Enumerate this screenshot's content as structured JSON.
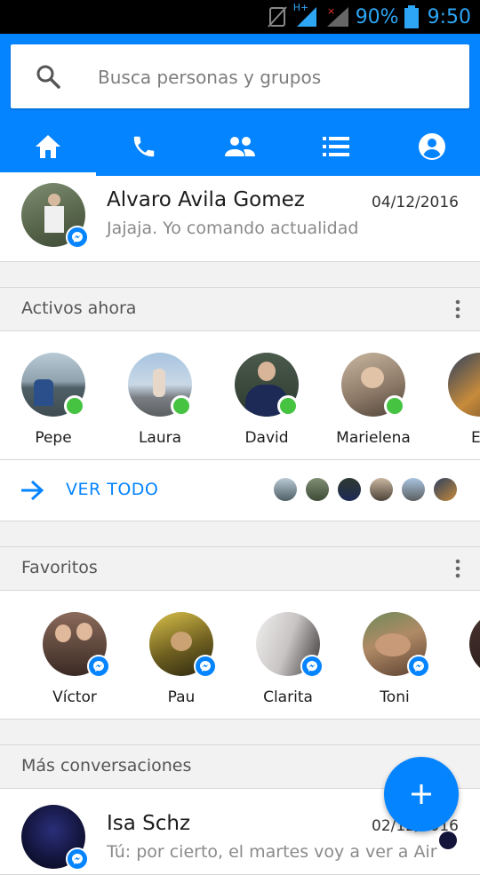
{
  "status_bar": {
    "network": "H+",
    "battery": "90%",
    "time": "9:50"
  },
  "search": {
    "placeholder": "Busca personas y grupos"
  },
  "tabs": [
    {
      "icon": "home-icon",
      "active": true
    },
    {
      "icon": "phone-icon",
      "active": false
    },
    {
      "icon": "people-icon",
      "active": false
    },
    {
      "icon": "list-icon",
      "active": false
    },
    {
      "icon": "profile-icon",
      "active": false
    }
  ],
  "top_conversation": {
    "name": "Alvaro Avila Gomez",
    "date": "04/12/2016",
    "message": "Jajaja. Yo comando actualidad"
  },
  "active_now": {
    "title": "Activos ahora",
    "people": [
      {
        "name": "Pepe"
      },
      {
        "name": "Laura"
      },
      {
        "name": "David"
      },
      {
        "name": "Marielena"
      },
      {
        "name": "Ec"
      }
    ],
    "see_all_label": "VER TODO"
  },
  "favorites": {
    "title": "Favoritos",
    "people": [
      {
        "name": "Víctor"
      },
      {
        "name": "Pau"
      },
      {
        "name": "Clarita"
      },
      {
        "name": "Toni"
      }
    ]
  },
  "more_conversations": {
    "title": "Más conversaciones",
    "items": [
      {
        "name": "Isa Schz",
        "date": "02/12/2016",
        "message": "Tú: por cierto, el martes voy a ver a Air"
      }
    ]
  },
  "colors": {
    "accent": "#0584ff",
    "online": "#45c341",
    "status_text": "#2ca6f5"
  }
}
